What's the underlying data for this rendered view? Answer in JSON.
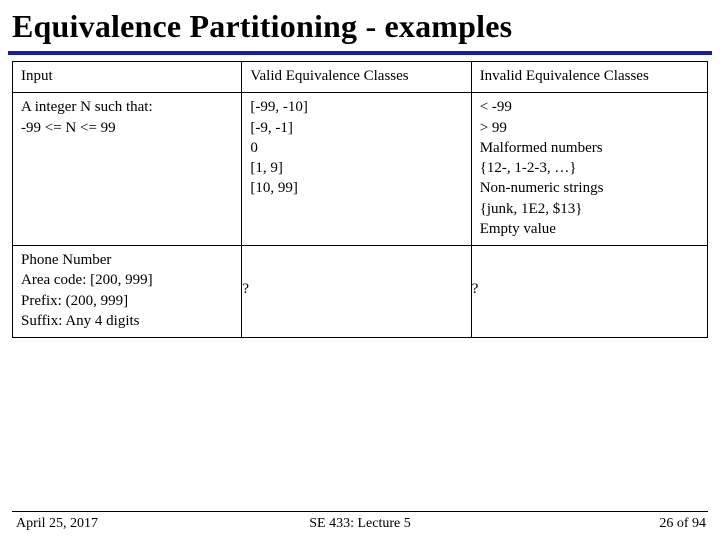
{
  "title": "Equivalence Partitioning - examples",
  "table": {
    "headers": {
      "input": "Input",
      "valid": "Valid Equivalence Classes",
      "invalid": "Invalid Equivalence Classes"
    },
    "rows": [
      {
        "input": "A integer N such that:\n-99 <= N <= 99",
        "valid": "[-99, -10]\n[-9, -1]\n0\n[1, 9]\n[10, 99]",
        "invalid": "< -99\n> 99\nMalformed numbers\n {12-, 1-2-3, …}\nNon-numeric strings\n {junk, 1E2, $13}\nEmpty value"
      },
      {
        "input": "Phone Number\nArea code: [200, 999]\nPrefix: (200, 999]\nSuffix: Any 4 digits",
        "valid": "?",
        "invalid": "?"
      }
    ]
  },
  "footer": {
    "date": "April 25, 2017",
    "center": "SE 433: Lecture 5",
    "page": "26 of 94"
  }
}
